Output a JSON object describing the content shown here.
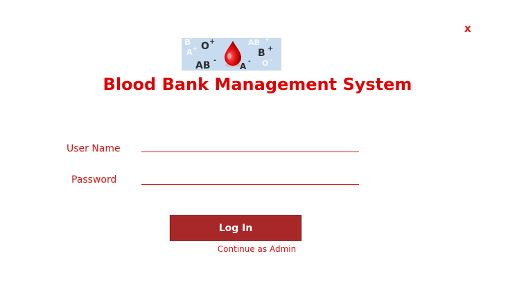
{
  "window": {
    "close_label": "x"
  },
  "logo": {
    "glyphs": [
      "B",
      "O",
      "+",
      "A",
      "+",
      "AB",
      "+",
      "B",
      "+",
      "AB",
      "-",
      "A",
      "-",
      "O",
      "-",
      "-"
    ]
  },
  "app": {
    "title": "Blood Bank Management System"
  },
  "form": {
    "username_label": "User Name",
    "username_value": "",
    "password_label": "Password",
    "password_value": ""
  },
  "actions": {
    "login_label": "Log In",
    "admin_link": "Continue as Admin"
  },
  "colors": {
    "accent": "#e00000",
    "button": "#a8282a",
    "logo_background": "#c8dcf0"
  },
  "icons": {
    "close": "close-icon",
    "logo": "blood-drop-icon"
  }
}
